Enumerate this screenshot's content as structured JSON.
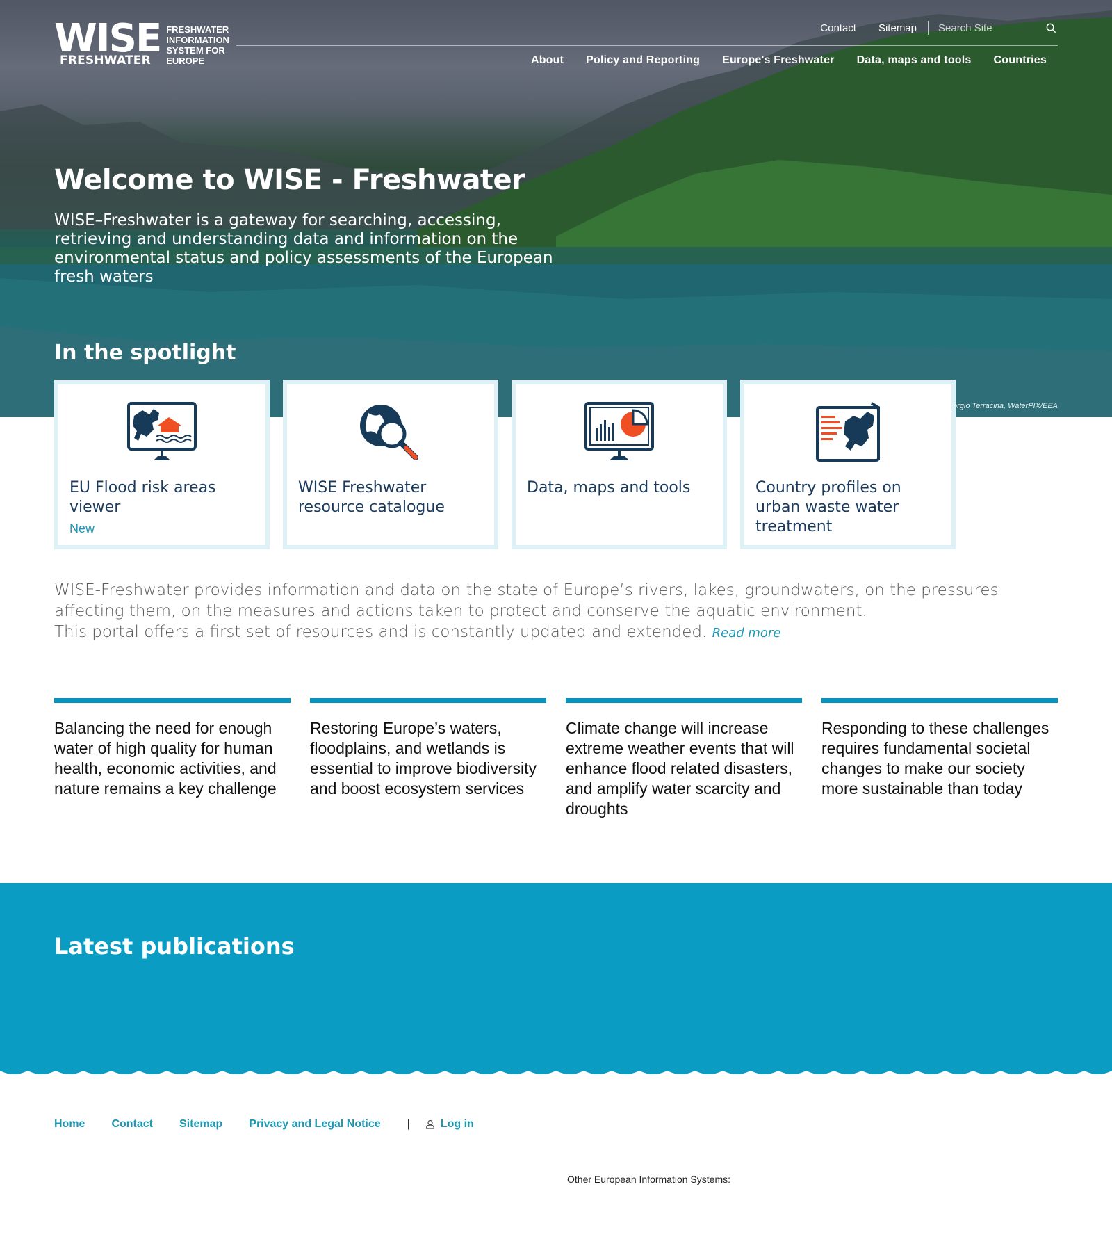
{
  "header": {
    "logo_wise": "WISE",
    "logo_freshwater": "FRESHWATER",
    "logo_sub": [
      "FRESHWATER",
      "INFORMATION",
      "SYSTEM FOR",
      "EUROPE"
    ],
    "top_links": {
      "contact": "Contact",
      "sitemap": "Sitemap"
    },
    "search_placeholder": "Search Site",
    "main_nav": [
      "About",
      "Policy and Reporting",
      "Europe's Freshwater",
      "Data, maps and tools",
      "Countries"
    ]
  },
  "hero": {
    "title": "Welcome to WISE - Freshwater",
    "description": "WISE–Freshwater is a gateway for searching, accessing, retrieving and understanding data and information on the environmental status and policy assessments of the European fresh waters",
    "credit": "orgio Terracina, WaterPIX/EEA"
  },
  "spotlight": {
    "title": "In the spotlight",
    "cards": [
      {
        "label": "EU Flood risk areas viewer",
        "tag": "New",
        "icon": "flood-map-monitor-icon"
      },
      {
        "label": "WISE Freshwater resource catalogue",
        "tag": "",
        "icon": "globe-magnifier-icon"
      },
      {
        "label": "Data, maps and tools",
        "tag": "",
        "icon": "chart-monitor-icon"
      },
      {
        "label": "Country profiles on urban waste water treatment",
        "tag": "",
        "icon": "europe-map-report-icon"
      }
    ]
  },
  "intro": {
    "line1": "WISE-Freshwater provides information and data on the state of Europe’s rivers, lakes, groundwaters, on the pressures affecting them, on the measures and actions taken to protect and conserve the aquatic environment.",
    "line2": "This portal offers a first set of resources and is constantly updated and extended.",
    "read_more": "Read more"
  },
  "challenges": [
    "Balancing the need for enough water of high quality for human health, economic activities, and nature remains a key challenge",
    "Restoring Europe’s waters, floodplains, and wetlands is essential to improve biodiversity and boost ecosystem services",
    "Climate change will increase extreme weather events that will enhance flood related disasters, and amplify water scarcity and droughts",
    "Responding to these challenges requires fundamental societal changes to make our society more sustainable than today"
  ],
  "publications": {
    "title": "Latest publications"
  },
  "footer": {
    "links": [
      "Home",
      "Contact",
      "Sitemap",
      "Privacy and Legal Notice"
    ],
    "separator": "|",
    "login": "Log in",
    "other_systems": "Other European Information Systems:"
  },
  "colors": {
    "accent": "#0a94bd",
    "publications_bg": "#0a9cc3",
    "card_border": "#ddf1f7",
    "card_text": "#1b3a5c",
    "icon_dark": "#163a57",
    "icon_orange": "#f04e23"
  }
}
